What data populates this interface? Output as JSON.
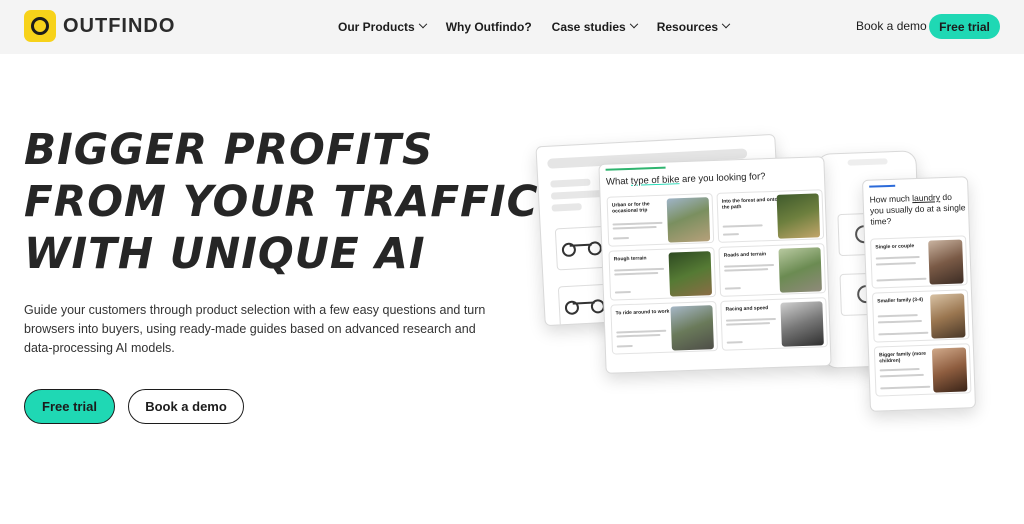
{
  "brand": {
    "name": "OUTFINDO",
    "logo_color": "#f7d21a"
  },
  "nav": {
    "items": [
      {
        "label": "Our Products",
        "has_dropdown": true
      },
      {
        "label": "Why Outfindo?",
        "has_dropdown": false
      },
      {
        "label": "Case studies",
        "has_dropdown": true
      },
      {
        "label": "Resources",
        "has_dropdown": true
      }
    ],
    "book_demo": "Book a demo",
    "free_trial": "Free trial"
  },
  "hero": {
    "headline": [
      "BIGGER PROFITS",
      "FROM YOUR TRAFFIC",
      "WITH UNIQUE AI"
    ],
    "subtext": "Guide your customers through product selection with a few easy questions and turn browsers into buyers, using ready-made guides based on advanced research and data-processing AI models.",
    "cta_trial": "Free trial",
    "cta_demo": "Book a demo"
  },
  "illustration": {
    "bike_question": "What type of bike are you looking for?",
    "bike_question_parts": {
      "before": "What ",
      "underlined": "type of bike",
      "after": " are you looking for?"
    },
    "bike_options": [
      "Urban or for the occasional trip",
      "Into the forest and onto the path",
      "Rough terrain",
      "Roads and terrain",
      "To ride around to work",
      "Racing and speed"
    ],
    "laundry_question_parts": {
      "before": "How much ",
      "underlined": "laundry",
      "after": " do you usually do at a single time?"
    },
    "laundry_options": [
      "Single or couple",
      "Smaller family (3-4)",
      "Bigger family (more children)"
    ]
  },
  "colors": {
    "accent": "#1fd8b4",
    "text": "#1c1c1c",
    "nav_bg": "#f4f4f4"
  }
}
